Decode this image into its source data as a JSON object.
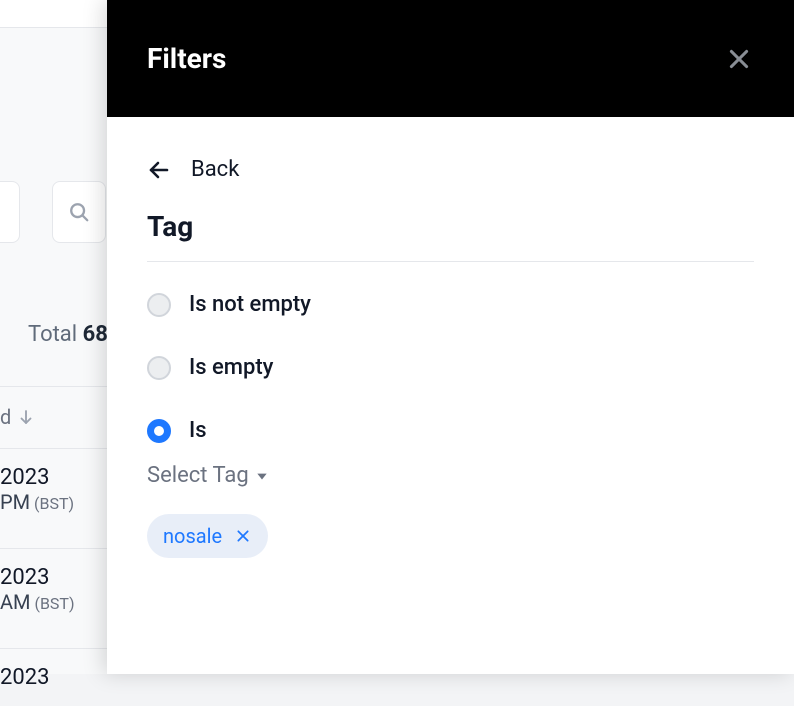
{
  "panel": {
    "title": "Filters",
    "back_label": "Back",
    "field_title": "Tag",
    "options": {
      "is_not_empty": "Is not empty",
      "is_empty": "Is empty",
      "is": "Is"
    },
    "select_tag_label": "Select Tag",
    "selected_tag": "nosale"
  },
  "backdrop": {
    "total_label": "Total",
    "total_value": "68",
    "column_header": "d",
    "rows": [
      {
        "year": "2023",
        "time": "PM",
        "tz": "(BST)"
      },
      {
        "year": "2023",
        "time": "AM",
        "tz": "(BST)"
      },
      {
        "year": "2023",
        "time": "",
        "tz": ""
      }
    ]
  }
}
